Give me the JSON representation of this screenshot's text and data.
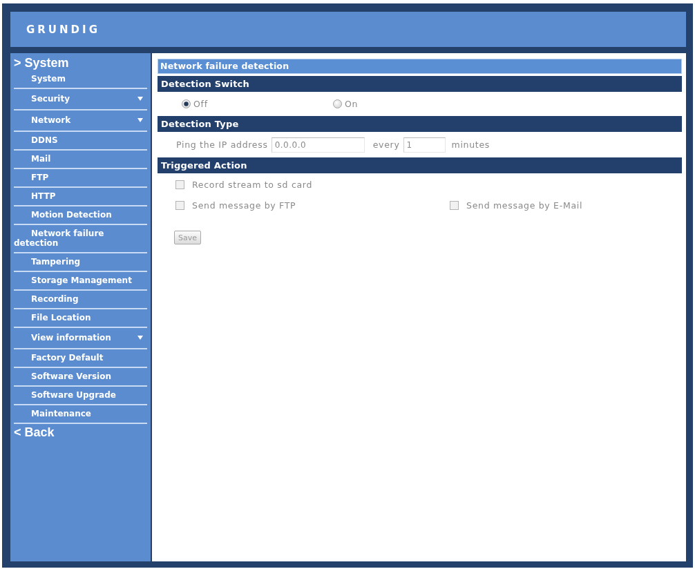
{
  "header": {
    "logo": "GRUNDIG"
  },
  "sidebar": {
    "heading": "> System",
    "items": [
      {
        "label": "System",
        "kind": "page"
      },
      {
        "label": "Security",
        "kind": "group"
      },
      {
        "label": "Network",
        "kind": "group"
      },
      {
        "label": "DDNS",
        "kind": "page"
      },
      {
        "label": "Mail",
        "kind": "page"
      },
      {
        "label": "FTP",
        "kind": "page"
      },
      {
        "label": "HTTP",
        "kind": "page"
      },
      {
        "label": "Motion Detection",
        "kind": "page"
      },
      {
        "label": "Network failure detection",
        "kind": "page"
      },
      {
        "label": "Tampering",
        "kind": "page"
      },
      {
        "label": "Storage Management",
        "kind": "page"
      },
      {
        "label": "Recording",
        "kind": "page"
      },
      {
        "label": "File Location",
        "kind": "page"
      },
      {
        "label": "View information",
        "kind": "group"
      },
      {
        "label": "Factory Default",
        "kind": "page"
      },
      {
        "label": "Software Version",
        "kind": "page"
      },
      {
        "label": "Software Upgrade",
        "kind": "page"
      },
      {
        "label": "Maintenance",
        "kind": "page"
      }
    ],
    "back": "< Back"
  },
  "content": {
    "title": "Network failure detection",
    "sections": [
      {
        "kind": "radio",
        "title": "Detection Switch",
        "options": [
          {
            "label": "Off",
            "selected": true
          },
          {
            "label": "On",
            "selected": false
          }
        ]
      },
      {
        "kind": "ping",
        "title": "Detection Type",
        "label": "Ping the IP address",
        "address": "0.0.0.0",
        "every_label": "every",
        "interval": "1",
        "unit": "minutes"
      },
      {
        "kind": "checks",
        "title": "Triggered Action",
        "rows": [
          [
            {
              "label": "Record stream to sd card",
              "checked": false
            }
          ],
          [
            {
              "label": "Send message by FTP",
              "checked": false
            },
            {
              "label": "Send message by E-Mail",
              "checked": false
            }
          ]
        ]
      }
    ],
    "save_button": "Save"
  }
}
